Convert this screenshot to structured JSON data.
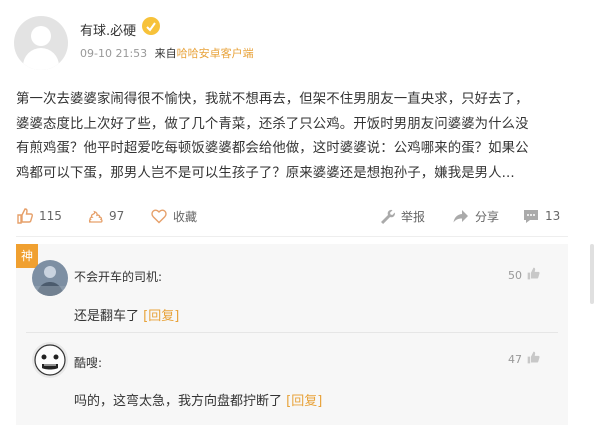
{
  "post": {
    "username": "有球.必硬",
    "badge": "",
    "time": "09-10 21:53",
    "from_label": "来自",
    "app": "哈哈安卓客户端",
    "lines": [
      "第一次去婆婆家闹得很不愉快，我就不想再去，但架不住男朋友一直央求，只好去了，",
      "婆婆态度比上次好了些，做了几个青菜，还杀了只公鸡。开饭时男朋友问婆婆为什么没",
      "有煎鸡蛋？他平时超爱吃每顿饭婆婆都会给他做，这时婆婆说：公鸡哪来的蛋？如果公",
      "鸡都可以下蛋，那男人岂不是可以生孩子了？原来婆婆还是想抱孙子，嫌我是男人..."
    ]
  },
  "actions": {
    "like_count": "115",
    "poop_count": "97",
    "favorite_label": "收藏",
    "report_label": "举报",
    "share_label": "分享",
    "comment_count": "13"
  },
  "comments": {
    "hot_tag": "神",
    "items": [
      {
        "name": "不会开车的司机:",
        "text": "还是翻车了",
        "reply": "[回复]",
        "likes": "50"
      },
      {
        "name": "酷嗖:",
        "text": "吗的，这弯太急，我方向盘都拧断了",
        "reply": "[回复]",
        "likes": "47"
      }
    ]
  },
  "colors": {
    "accent": "#e8a33b",
    "hot_tag": "#f0a030"
  }
}
